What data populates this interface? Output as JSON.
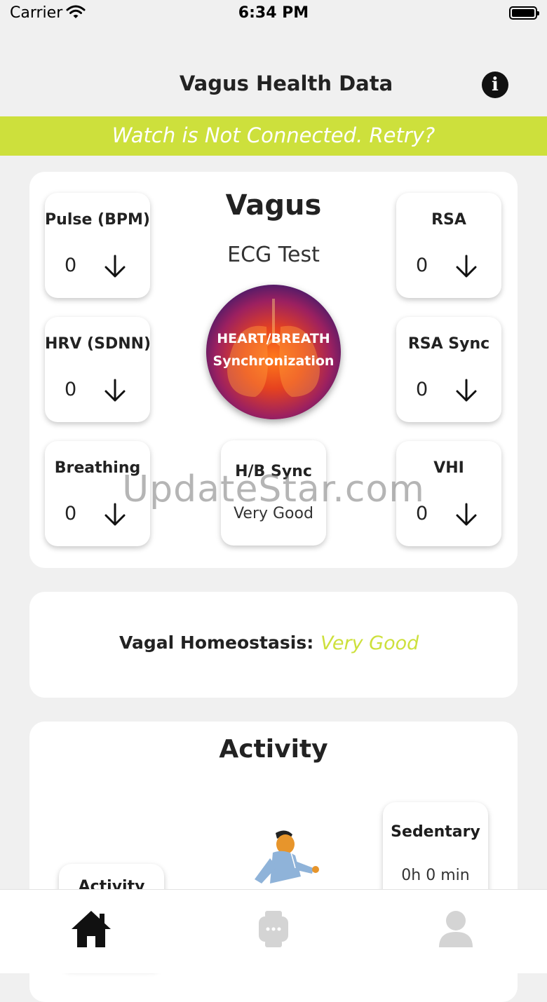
{
  "status_bar": {
    "carrier": "Carrier",
    "time": "6:34 PM"
  },
  "nav": {
    "title": "Vagus Health Data",
    "info_icon": "info-icon"
  },
  "banner": {
    "text": "Watch is Not Connected. Retry?",
    "color": "#cde03c"
  },
  "vagus_card": {
    "title": "Vagus",
    "subtitle": "ECG Test",
    "circle": {
      "line1": "HEART/BREATH",
      "line2": "Synchronization"
    },
    "metrics": {
      "pulse": {
        "label": "Pulse (BPM)",
        "value": "0",
        "trend_icon": "arrow-down-icon"
      },
      "rsa": {
        "label": "RSA",
        "value": "0",
        "trend_icon": "arrow-down-icon"
      },
      "hrv": {
        "label": "HRV (SDNN)",
        "value": "0",
        "trend_icon": "arrow-down-icon"
      },
      "rsa_sync": {
        "label": "RSA Sync",
        "value": "0",
        "trend_icon": "arrow-down-icon"
      },
      "breathing": {
        "label": "Breathing",
        "value": "0",
        "trend_icon": "arrow-down-icon"
      },
      "vhi": {
        "label": "VHI",
        "value": "0",
        "trend_icon": "arrow-down-icon"
      }
    },
    "hb_sync": {
      "label": "H/B Sync",
      "value": "Very Good"
    }
  },
  "watermark": "UpdateStar.com",
  "homeostasis": {
    "label": "Vagal Homeostasis:",
    "value": "Very Good",
    "value_color": "#cde03c"
  },
  "activity": {
    "title": "Activity",
    "sedentary": {
      "label": "Sedentary",
      "value": "0h 0 min"
    },
    "activity_box": {
      "label": "Activity"
    }
  },
  "tabbar": {
    "tabs": [
      {
        "icon": "home-icon",
        "active": true
      },
      {
        "icon": "watch-icon",
        "active": false
      },
      {
        "icon": "profile-icon",
        "active": false
      }
    ]
  }
}
